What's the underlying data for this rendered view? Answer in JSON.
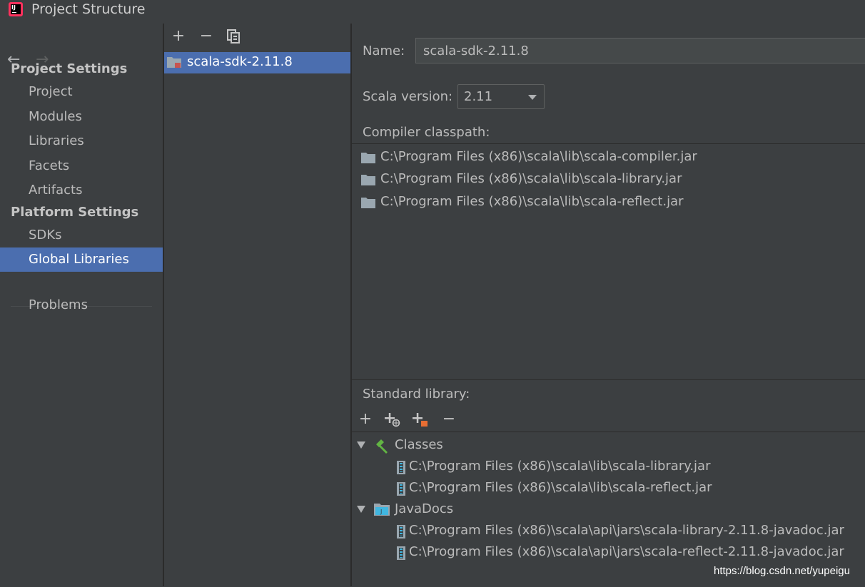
{
  "window": {
    "title": "Project Structure",
    "app_icon": "intellij-icon"
  },
  "nav": {
    "back": "←",
    "forward": "→"
  },
  "sidebar": {
    "project_settings_header": "Project Settings",
    "project_settings_items": [
      {
        "label": "Project"
      },
      {
        "label": "Modules"
      },
      {
        "label": "Libraries"
      },
      {
        "label": "Facets"
      },
      {
        "label": "Artifacts"
      }
    ],
    "platform_settings_header": "Platform Settings",
    "platform_settings_items": [
      {
        "label": "SDKs"
      },
      {
        "label": "Global Libraries",
        "selected": true
      }
    ],
    "problems_label": "Problems"
  },
  "libraries_pane": {
    "toolbar": {
      "add": "+",
      "remove": "−",
      "copy_icon": "copy-icon"
    },
    "items": [
      {
        "label": "scala-sdk-2.11.8",
        "selected": true
      }
    ]
  },
  "details": {
    "name_label": "Name:",
    "name_value": "scala-sdk-2.11.8",
    "scala_version_label": "Scala version:",
    "scala_version_value": "2.11",
    "compiler_classpath_label": "Compiler classpath:",
    "compiler_classpath": [
      "C:\\Program Files (x86)\\scala\\lib\\scala-compiler.jar",
      "C:\\Program Files (x86)\\scala\\lib\\scala-library.jar",
      "C:\\Program Files (x86)\\scala\\lib\\scala-reflect.jar"
    ],
    "standard_library_label": "Standard library:",
    "standard_library_toolbar": [
      "add-icon",
      "add-from-maven-icon",
      "add-jar-icon",
      "remove-icon"
    ],
    "tree": {
      "classes_label": "Classes",
      "classes": [
        "C:\\Program Files (x86)\\scala\\lib\\scala-library.jar",
        "C:\\Program Files (x86)\\scala\\lib\\scala-reflect.jar"
      ],
      "javadocs_label": "JavaDocs",
      "javadocs": [
        "C:\\Program Files (x86)\\scala\\api\\jars\\scala-library-2.11.8-javadoc.jar",
        "C:\\Program Files (x86)\\scala\\api\\jars\\scala-reflect-2.11.8-javadoc.jar"
      ]
    }
  },
  "watermark": "https://blog.csdn.net/yupeigu",
  "colors": {
    "background": "#3c3f41",
    "selection": "#4b6eaf",
    "text": "#bbbbbb"
  }
}
